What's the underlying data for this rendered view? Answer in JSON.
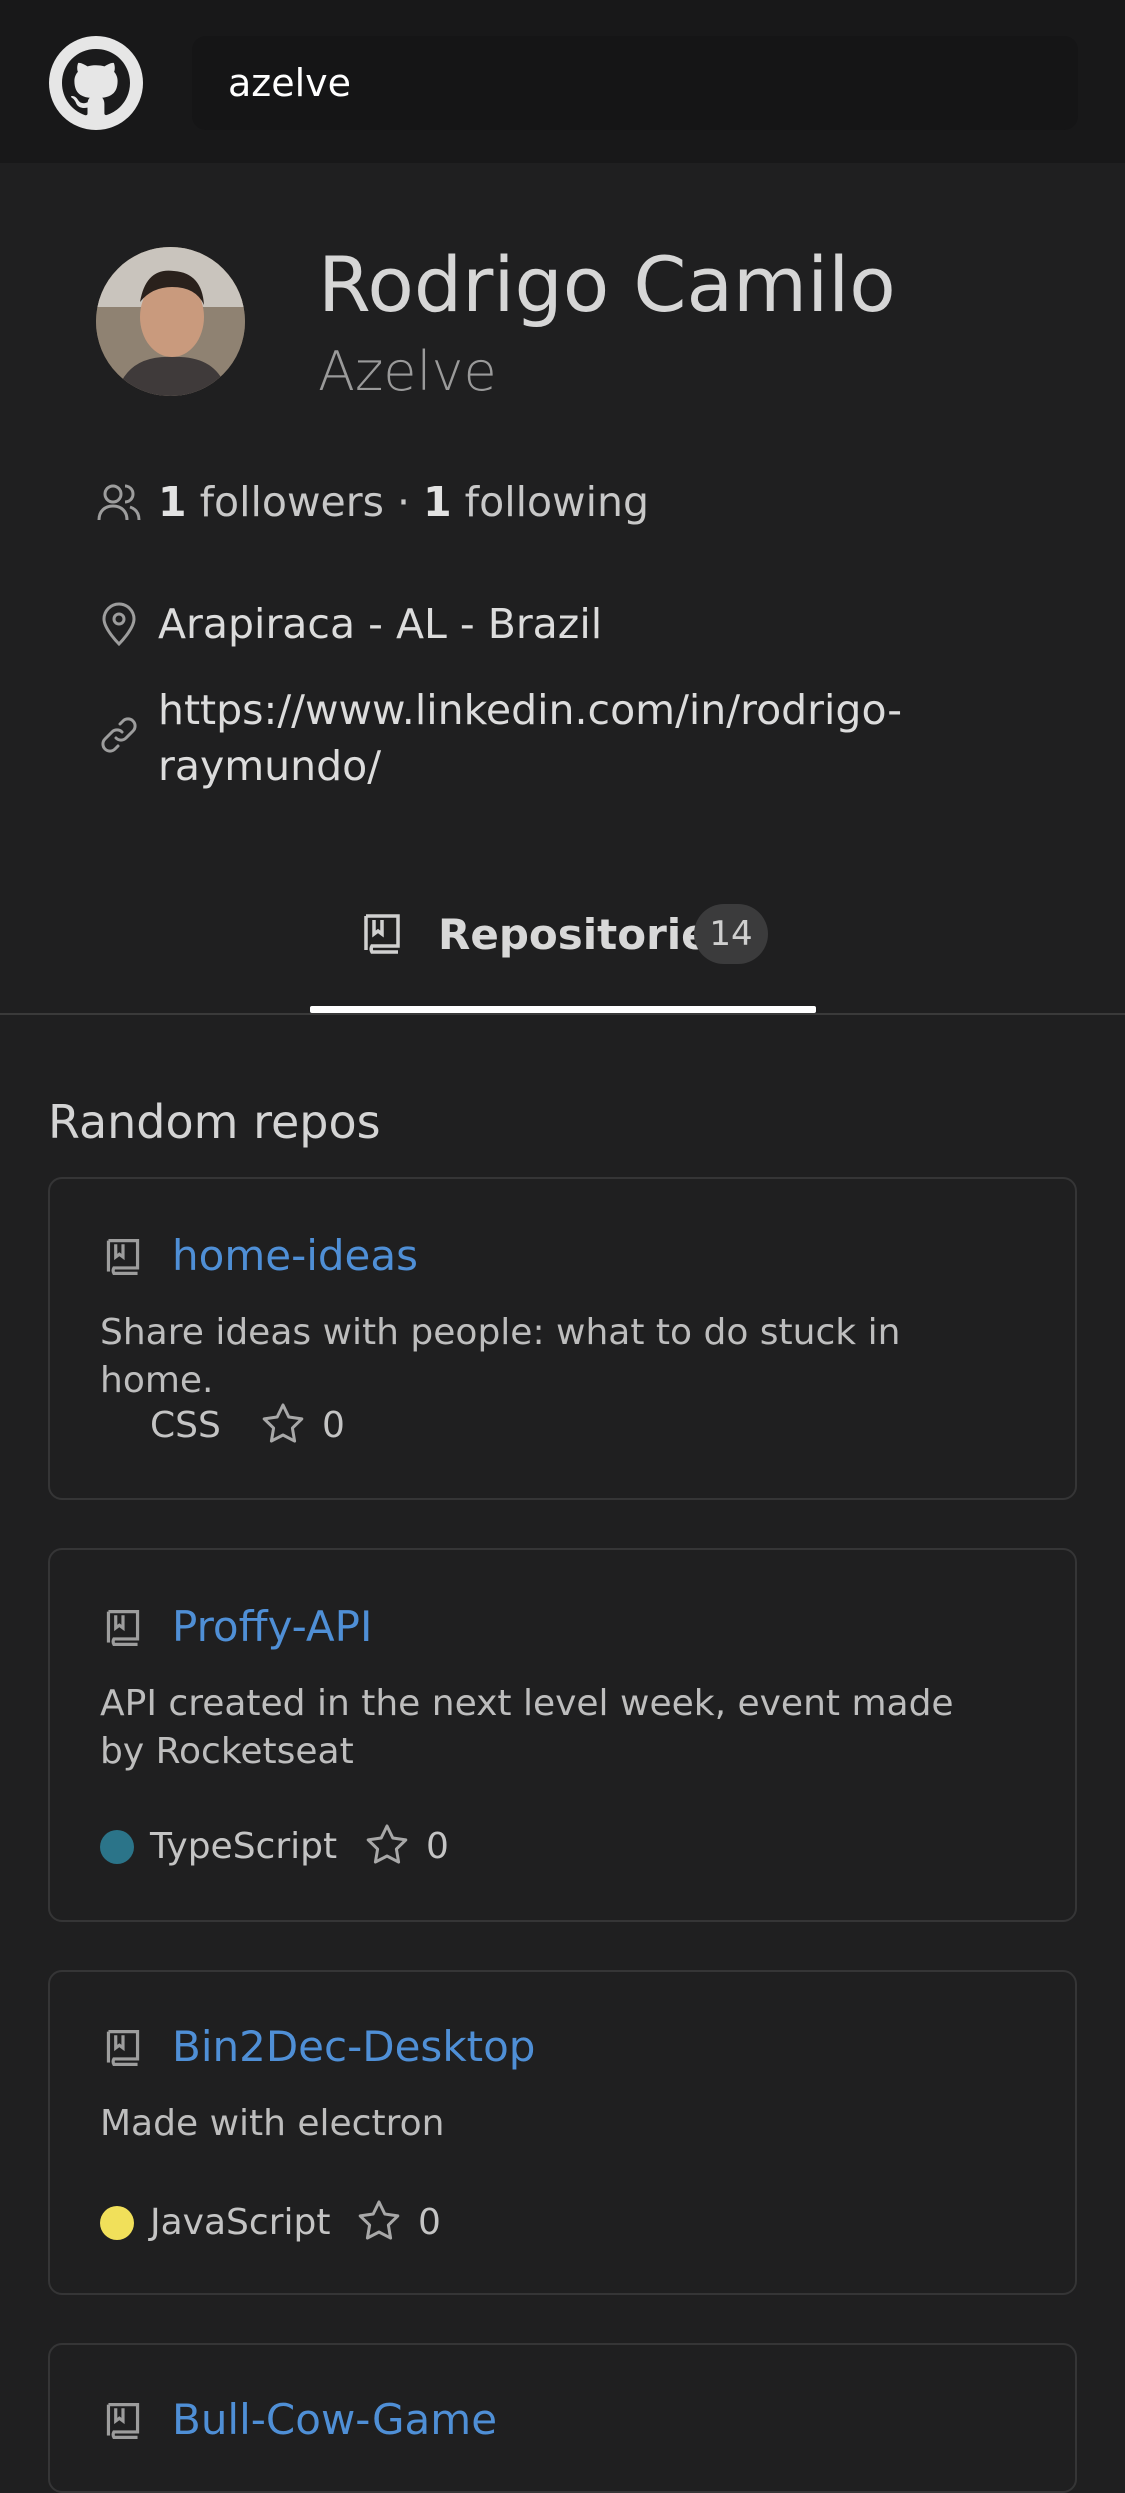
{
  "header": {
    "search_value": "azelve"
  },
  "profile": {
    "name": "Rodrigo Camilo",
    "login": "Azelve",
    "followers_count": "1",
    "followers_label": "followers",
    "separator": "·",
    "following_count": "1",
    "following_label": "following",
    "location": "Arapiraca - AL - Brazil",
    "website": "https://www.linkedin.com/in/rodrigo-raymundo/"
  },
  "tabs": {
    "repositories_label": "Repositories",
    "repositories_count": "14"
  },
  "random_repos": {
    "title": "Random repos",
    "items": [
      {
        "name": "home-ideas",
        "description": "Share ideas with people: what to do stuck in home.",
        "language": "CSS",
        "language_color": "#1f1f20",
        "stars": "0"
      },
      {
        "name": "Proffy-API",
        "description": "API created in the next level week, event made by Rocketseat",
        "language": "TypeScript",
        "language_color": "#2b7489",
        "stars": "0"
      },
      {
        "name": "Bin2Dec-Desktop",
        "description": "Made with electron",
        "language": "JavaScript",
        "language_color": "#f1e05a",
        "stars": "0"
      },
      {
        "name": "Bull-Cow-Game"
      }
    ]
  },
  "colors": {
    "background": "#1f1f20",
    "header": "#181819",
    "link": "#4f8fd6",
    "tab_underline": "#ffffff"
  },
  "icons": [
    "github-logo-icon",
    "people-icon",
    "location-pin-icon",
    "link-icon",
    "repo-book-icon",
    "star-icon"
  ]
}
